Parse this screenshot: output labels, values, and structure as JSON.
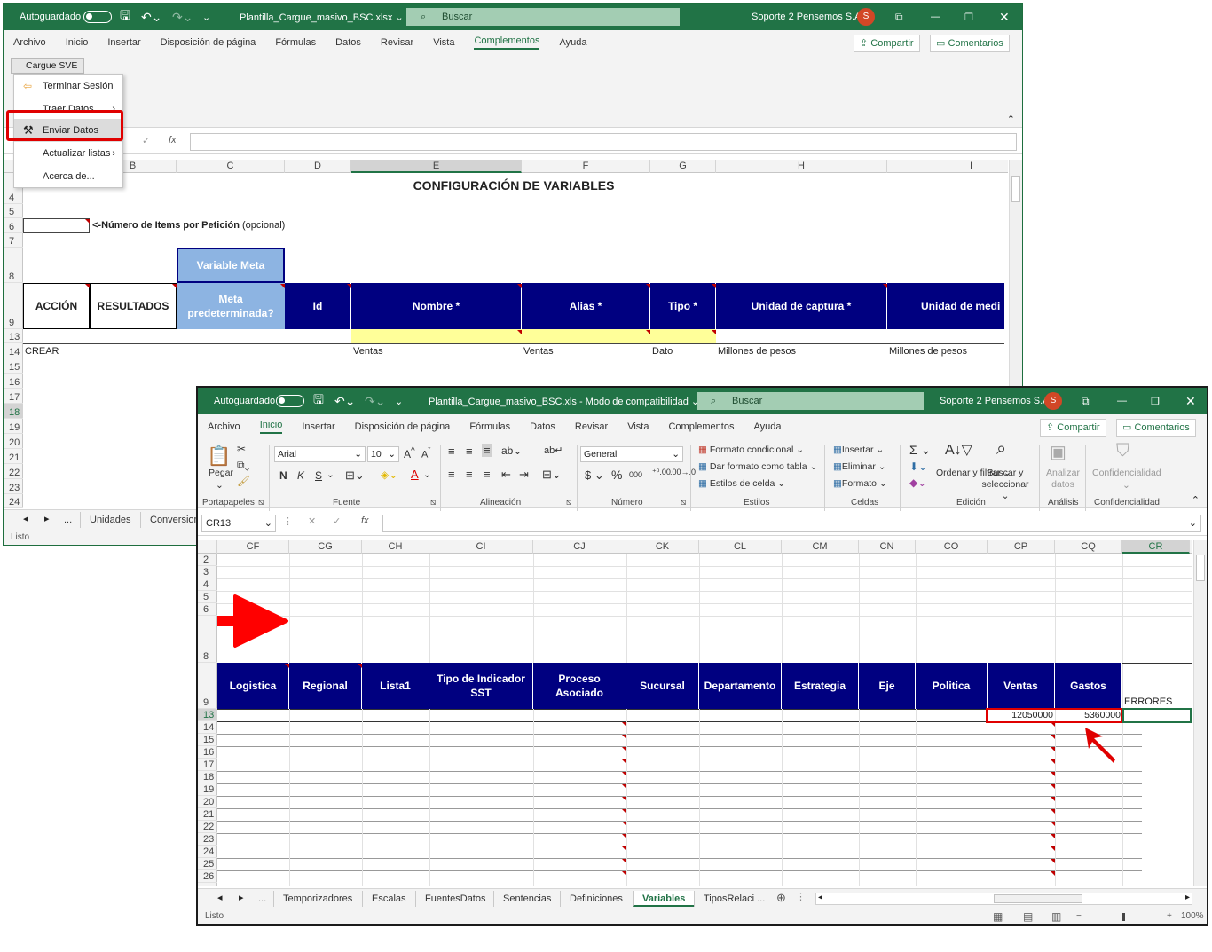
{
  "win1": {
    "autosave": "Autoguardado",
    "filename": "Plantilla_Cargue_masivo_BSC.xlsx",
    "search": "Buscar",
    "user": "Soporte 2 Pensemos S.A.",
    "avatar": "S",
    "menu": [
      "Archivo",
      "Inicio",
      "Insertar",
      "Disposición de página",
      "Fórmulas",
      "Datos",
      "Revisar",
      "Vista",
      "Complementos",
      "Ayuda"
    ],
    "share": "Compartir",
    "comments": "Comentarios",
    "addin_button": "Cargue SVE",
    "dropdown": [
      "Terminar Sesión",
      "Traer Datos",
      "Enviar Datos",
      "Actualizar listas",
      "Acerca de..."
    ],
    "columns": [
      "B",
      "C",
      "D",
      "E",
      "F",
      "G",
      "H",
      "I"
    ],
    "rows": [
      "4",
      "5",
      "6",
      "7",
      "8",
      "9",
      "13",
      "14",
      "15",
      "16",
      "17",
      "18",
      "19",
      "20",
      "21",
      "22",
      "23",
      "24"
    ],
    "title": "CONFIGURACIÓN DE VARIABLES",
    "items_note_bold": "<-Número de Items por Petición",
    "items_note_rest": " (opcional)",
    "variable_meta": "Variable Meta",
    "headers": [
      "ACCIÓN",
      "RESULTADOS",
      "Meta predeterminada?",
      "Id",
      "Nombre *",
      "Alias *",
      "Tipo *",
      "Unidad de captura *",
      "Unidad de medi"
    ],
    "row14": {
      "a": "CREAR",
      "e": "Ventas",
      "f": "Ventas",
      "g": "Dato",
      "h": "Millones de pesos",
      "i": "Millones de pesos"
    },
    "tabs": [
      "...",
      "Unidades",
      "Conversion"
    ],
    "status": "Listo"
  },
  "win2": {
    "autosave": "Autoguardado",
    "filename": "Plantilla_Cargue_masivo_BSC.xls  -  Modo de compatibilidad",
    "search": "Buscar",
    "user": "Soporte 2 Pensemos S.A.",
    "avatar": "S",
    "menu": [
      "Archivo",
      "Inicio",
      "Insertar",
      "Disposición de página",
      "Fórmulas",
      "Datos",
      "Revisar",
      "Vista",
      "Complementos",
      "Ayuda"
    ],
    "share": "Compartir",
    "comments": "Comentarios",
    "ribbon": {
      "paste": "Pegar",
      "font": "Arial",
      "size": "10",
      "bold": "N",
      "italic": "K",
      "underline": "S",
      "number_format": "General",
      "cond_format": "Formato condicional",
      "table_format": "Dar formato como tabla",
      "cell_styles": "Estilos de celda",
      "insert": "Insertar",
      "delete": "Eliminar",
      "format": "Formato",
      "sort": "Ordenar y filtrar",
      "find": "Buscar y seleccionar",
      "analyze": "Analizar datos",
      "confidential": "Confidencialidad",
      "groups": [
        "Portapapeles",
        "Fuente",
        "Alineación",
        "Número",
        "Estilos",
        "Celdas",
        "Edición",
        "Análisis",
        "Confidencialidad"
      ]
    },
    "namebox": "CR13",
    "columns": [
      "CF",
      "CG",
      "CH",
      "CI",
      "CJ",
      "CK",
      "CL",
      "CM",
      "CN",
      "CO",
      "CP",
      "CQ",
      "CR"
    ],
    "rows": [
      "2",
      "3",
      "4",
      "5",
      "6",
      "8",
      "9",
      "13",
      "14",
      "15",
      "16",
      "17",
      "18",
      "19",
      "20",
      "21",
      "22",
      "23",
      "24",
      "25",
      "26"
    ],
    "headers": [
      "Logistica",
      "Regional",
      "Lista1",
      "Tipo de Indicador SST",
      "Proceso Asociado",
      "Sucursal",
      "Departamento",
      "Estrategia",
      "Eje",
      "Politica",
      "Ventas",
      "Gastos"
    ],
    "errors": "ERRORES",
    "cp13": "12050000",
    "cq13": "5360000",
    "tabs": [
      "...",
      "Temporizadores",
      "Escalas",
      "FuentesDatos",
      "Sentencias",
      "Definiciones",
      "Variables",
      "TiposRelaci ..."
    ],
    "status": "Listo",
    "zoom": "100%",
    "colors": {
      "excel_green": "#217346",
      "header_navy": "#000080",
      "meta_blue": "#8db4e2",
      "highlight_yellow": "#ffff99",
      "annotation_red": "#e00000"
    }
  }
}
